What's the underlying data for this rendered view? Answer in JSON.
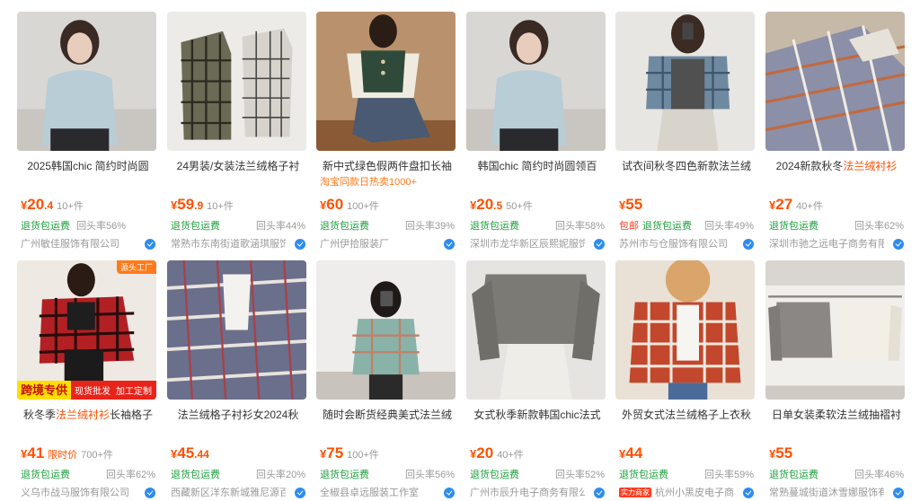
{
  "colors": {
    "accent": "#ff5000",
    "return_green": "#1a9f3b",
    "muted": "#999999"
  },
  "labels": {
    "return_label": "退货包运费",
    "return_label_short": "退货包运费"
  },
  "products": [
    {
      "title": "2025韩国chic 简约时尚圆",
      "price_int": "20",
      "price_dec": ".4",
      "qty": "10+件",
      "package": "",
      "rate": "回头率56%",
      "shop": "广州敏佳服饰有限公司",
      "sub": ""
    },
    {
      "title": "24男装/女装法兰绒格子衬",
      "price_int": "59",
      "price_dec": ".9",
      "qty": "10+件",
      "package": "",
      "rate": "回头率44%",
      "shop": "常熟市东南街道歌涵琪服饰",
      "sub": ""
    },
    {
      "title": "新中式绿色假两件盘扣长袖",
      "price_int": "60",
      "price_dec": "",
      "qty": "100+件",
      "package": "",
      "rate": "回头率39%",
      "shop": "广州伊拾服装厂",
      "sub": "淘宝同款日热卖1000+"
    },
    {
      "title": "韩国chic 简约时尚圆领百",
      "price_int": "20",
      "price_dec": ".5",
      "qty": "50+件",
      "package": "",
      "rate": "回头率58%",
      "shop": "深圳市龙华新区辰熙妮服饰",
      "sub": ""
    },
    {
      "title": "试衣间秋冬四色新款法兰绒",
      "price_int": "55",
      "price_dec": "",
      "qty": "",
      "package": "包邮",
      "rate": "回头率49%",
      "shop": "苏州市与仓服饰有限公司",
      "sub": ""
    },
    {
      "title_pre": "2024新款秋冬",
      "title_hl": "法兰绒衬衫",
      "title_post": "",
      "price_int": "27",
      "price_dec": "",
      "qty": "40+件",
      "package": "",
      "rate": "回头率62%",
      "shop": "深圳市驰之远电子商务有限",
      "sub": ""
    },
    {
      "title_pre": "秋冬季",
      "title_hl": "法兰绒衬衫",
      "title_post": "长袖格子",
      "price_int": "41",
      "price_dec": "",
      "limit": "限时价",
      "qty": "700+件",
      "package": "",
      "rate": "回头率62%",
      "shop": "义乌市战马服饰有限公司",
      "corner": "源头工厂",
      "banner1": "跨境专供",
      "banner2": "现货批发",
      "banner3": "加工定制"
    },
    {
      "title": "法兰绒格子衬衫女2024秋",
      "price_int": "45",
      "price_dec": ".44",
      "qty": "",
      "package": "",
      "rate": "回头率20%",
      "shop": "西藏新区洋东新城雅尼源百"
    },
    {
      "title": "随时会断货经典美式法兰绒",
      "price_int": "75",
      "price_dec": "",
      "qty": "100+件",
      "package": "",
      "rate": "回头率56%",
      "shop": "全椒县卓远服装工作室"
    },
    {
      "title": "女式秋季新款韩国chic法式",
      "price_int": "20",
      "price_dec": "",
      "qty": "40+件",
      "package": "",
      "rate": "回头率52%",
      "shop": "广州市辰升电子商务有限公"
    },
    {
      "title": "外贸女式法兰绒格子上衣秋",
      "price_int": "44",
      "price_dec": "",
      "qty": "",
      "package": "",
      "strength": "实力商家",
      "rate": "回头率59%",
      "shop": "杭州小黑皮电子商"
    },
    {
      "title": "日单女装柔软法兰绒抽褶衬",
      "price_int": "55",
      "price_dec": "",
      "qty": "",
      "package": "",
      "rate": "回头率46%",
      "shop": "常熟蔓城街道沐雪娜服饰有"
    }
  ]
}
